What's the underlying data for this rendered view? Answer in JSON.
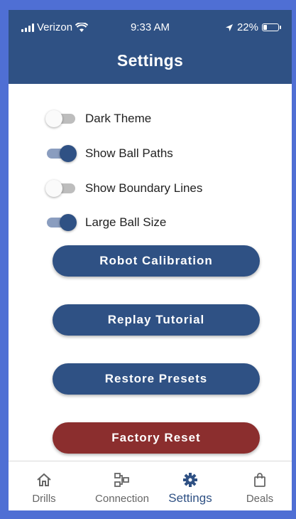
{
  "status_bar": {
    "carrier": "Verizon",
    "time": "9:33 AM",
    "battery": "22%"
  },
  "header": {
    "title": "Settings"
  },
  "toggles": [
    {
      "label": "Dark Theme",
      "on": false
    },
    {
      "label": "Show Ball Paths",
      "on": true
    },
    {
      "label": "Show Boundary Lines",
      "on": false
    },
    {
      "label": "Large Ball Size",
      "on": true
    }
  ],
  "buttons": {
    "robot_calibration": "Robot Calibration",
    "replay_tutorial": "Replay Tutorial",
    "restore_presets": "Restore Presets",
    "factory_reset": "Factory Reset"
  },
  "tabs": [
    {
      "label": "Drills",
      "icon": "home-icon",
      "active": false
    },
    {
      "label": "Connection",
      "icon": "network-icon",
      "active": false
    },
    {
      "label": "Settings",
      "icon": "gear-icon",
      "active": true
    },
    {
      "label": "Deals",
      "icon": "shopping-bag-icon",
      "active": false
    }
  ],
  "colors": {
    "primary": "#2f5184",
    "danger": "#8b2e2e",
    "border": "#4f6fd4"
  }
}
